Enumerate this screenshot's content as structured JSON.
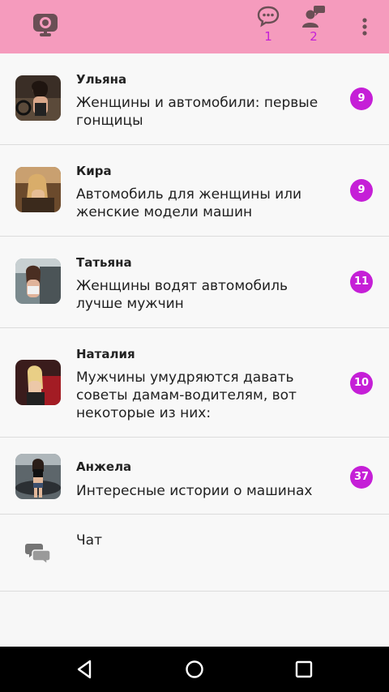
{
  "appbar": {
    "background": "#f59bbd",
    "accent": "#c51fd7",
    "messages_count": "1",
    "contacts_count": "2",
    "icons": [
      "webcam-logo-icon",
      "chat-bubble-icon",
      "contacts-icon",
      "overflow-menu-icon"
    ]
  },
  "rows": [
    {
      "name": "Ульяна",
      "title": "Женщины и автомобили: первые гонщицы",
      "badge": "9"
    },
    {
      "name": "Кира",
      "title": "Автомобиль для женщины или женские модели машин",
      "badge": "9"
    },
    {
      "name": "Татьяна",
      "title": "Женщины водят автомобиль лучше мужчин",
      "badge": "11"
    },
    {
      "name": "Наталия",
      "title": "Мужчины умудряются давать советы дамам-водителям, вот некоторые из них:",
      "badge": "10"
    },
    {
      "name": "Анжела",
      "title": "Интересные истории о машинах",
      "badge": "37"
    }
  ],
  "chat": {
    "label": "Чат"
  },
  "navbar": {
    "buttons": [
      "back-icon",
      "home-icon",
      "recents-icon"
    ]
  }
}
